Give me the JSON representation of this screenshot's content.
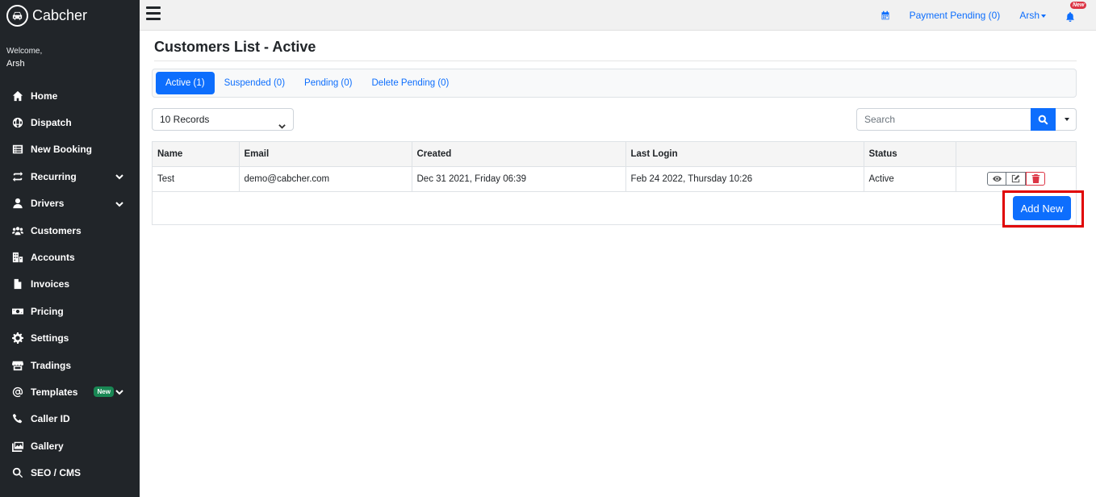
{
  "app": {
    "name": "Cabcher"
  },
  "sidebar": {
    "welcome_label": "Welcome,",
    "user": "Arsh",
    "items": [
      {
        "label": "Home",
        "icon": "home-icon"
      },
      {
        "label": "Dispatch",
        "icon": "globe-icon"
      },
      {
        "label": "New Booking",
        "icon": "list-icon"
      },
      {
        "label": "Recurring",
        "icon": "repeat-icon",
        "has_children": true
      },
      {
        "label": "Drivers",
        "icon": "user-icon",
        "has_children": true
      },
      {
        "label": "Customers",
        "icon": "users-icon"
      },
      {
        "label": "Accounts",
        "icon": "building-icon"
      },
      {
        "label": "Invoices",
        "icon": "file-icon"
      },
      {
        "label": "Pricing",
        "icon": "money-icon"
      },
      {
        "label": "Settings",
        "icon": "gear-icon"
      },
      {
        "label": "Tradings",
        "icon": "store-icon"
      },
      {
        "label": "Templates",
        "icon": "at-icon",
        "badge": "New",
        "has_children": true
      },
      {
        "label": "Caller ID",
        "icon": "phone-icon"
      },
      {
        "label": "Gallery",
        "icon": "images-icon"
      },
      {
        "label": "SEO / CMS",
        "icon": "search-icon"
      }
    ]
  },
  "topbar": {
    "payment_pending": "Payment Pending (0)",
    "user": "Arsh",
    "notification_badge": "New"
  },
  "page": {
    "title": "Customers List - Active",
    "tabs": [
      {
        "label": "Active (1)",
        "active": true
      },
      {
        "label": "Suspended (0)",
        "active": false
      },
      {
        "label": "Pending (0)",
        "active": false
      },
      {
        "label": "Delete Pending (0)",
        "active": false
      }
    ],
    "records_select": "10 Records",
    "search_placeholder": "Search",
    "table": {
      "headers": [
        "Name",
        "Email",
        "Created",
        "Last Login",
        "Status",
        ""
      ],
      "rows": [
        {
          "name": "Test",
          "email": "demo@cabcher.com",
          "created": "Dec 31 2021, Friday 06:39",
          "last_login": "Feb 24 2022, Thursday 10:26",
          "status": "Active"
        }
      ]
    },
    "add_new_label": "Add New"
  },
  "colors": {
    "sidebar_bg": "#212529",
    "primary": "#0d6efd",
    "danger": "#dc3545",
    "highlight": "#e00000",
    "badge_green": "#198754"
  }
}
